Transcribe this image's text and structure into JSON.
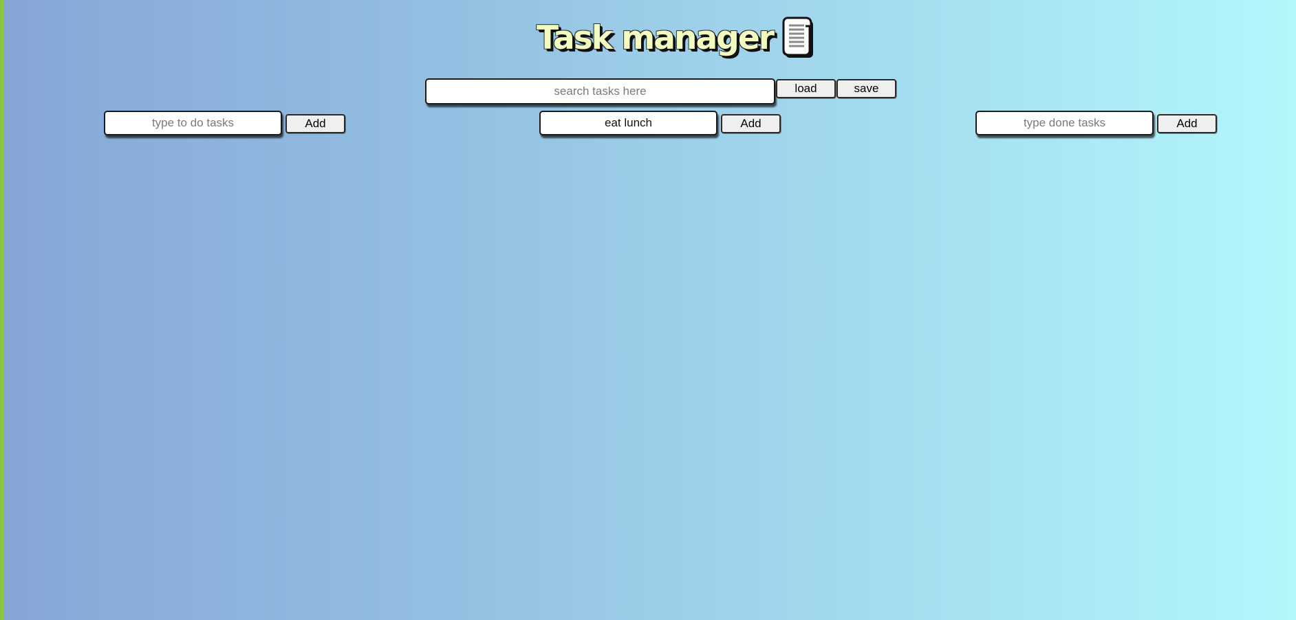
{
  "header": {
    "title": "Task manager",
    "icon": "scroll-icon"
  },
  "search": {
    "placeholder": "search tasks here",
    "value": "",
    "load_label": "load",
    "save_label": "save"
  },
  "columns": [
    {
      "placeholder": "type to do tasks",
      "value": "",
      "add_label": "Add"
    },
    {
      "placeholder": "",
      "value": "eat lunch",
      "add_label": "Add"
    },
    {
      "placeholder": "type done tasks",
      "value": "",
      "add_label": "Add"
    }
  ],
  "colors": {
    "gradient_start": "#86a6d6",
    "gradient_end": "#b3f7fb",
    "left_stripe": "#8cc63f",
    "title_fill": "#f2fbc0"
  }
}
